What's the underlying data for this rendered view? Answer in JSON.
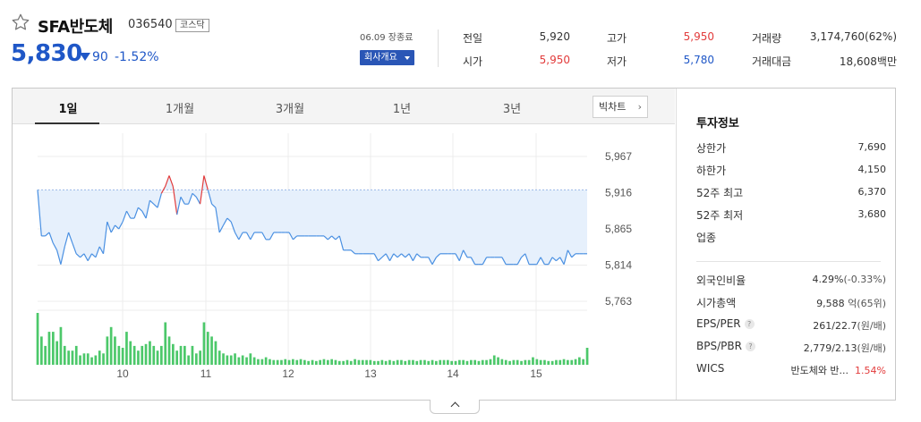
{
  "stock": {
    "name": "SFA반도체",
    "code": "036540",
    "market": "코스닥",
    "price": "5,830",
    "change": "90",
    "change_pct": "-1.52%",
    "date_label": "06.09 장종료",
    "company_btn": "회사개요"
  },
  "quote": [
    {
      "label": "전일",
      "value": "5,920",
      "color": "dark"
    },
    {
      "label": "시가",
      "value": "5,950",
      "color": "red"
    },
    {
      "label": "고가",
      "value": "5,950",
      "color": "red"
    },
    {
      "label": "저가",
      "value": "5,780",
      "color": "blue"
    },
    {
      "label": "거래량",
      "value": "3,174,760(62%)",
      "color": "dark"
    },
    {
      "label": "거래대금",
      "value": "18,608백만",
      "color": "dark"
    }
  ],
  "tabs": [
    "1일",
    "1개월",
    "3개월",
    "1년",
    "3년"
  ],
  "bigchart_label": "빅차트",
  "invest": {
    "title": "투자정보",
    "rows": [
      {
        "label": "상한가",
        "value": "7,690",
        "color": "red"
      },
      {
        "label": "하한가",
        "value": "4,150",
        "color": "blue"
      },
      {
        "label": "52주 최고",
        "value": "6,370",
        "color": "dark"
      },
      {
        "label": "52주 최저",
        "value": "3,680",
        "color": "dark"
      },
      {
        "label": "업종",
        "value": "",
        "color": "dark"
      }
    ],
    "rows2": [
      {
        "label": "외국인비율",
        "value": "4.29%",
        "extra": "(-0.33%)"
      },
      {
        "label": "시가총액",
        "value": "9,588",
        "extra": "억(65위)"
      },
      {
        "label": "EPS/PER",
        "value": "261/22.7",
        "extra": "(원/배)",
        "help": true
      },
      {
        "label": "BPS/PBR",
        "value": "2,779/2.13",
        "extra": "(원/배)",
        "help": true
      },
      {
        "label": "WICS",
        "value": "반도체와 반...",
        "extra": "1.54%"
      }
    ]
  },
  "colors": {
    "up": "#e23b3b",
    "down": "#1f57c7",
    "line": "#4a90e2",
    "area": "#e6f0fc",
    "volume": "#4cc86a"
  },
  "chart_data": {
    "type": "line",
    "y_ticks": [
      "5,967",
      "5,916",
      "5,865",
      "5,814",
      "5,763"
    ],
    "x_ticks": [
      "10",
      "11",
      "12",
      "13",
      "14",
      "15"
    ],
    "ylim": [
      5763,
      5967
    ],
    "prev_close": 5920,
    "price_series": [
      5920,
      5855,
      5855,
      5860,
      5845,
      5835,
      5815,
      5840,
      5860,
      5845,
      5830,
      5825,
      5830,
      5820,
      5830,
      5825,
      5840,
      5830,
      5875,
      5860,
      5870,
      5865,
      5875,
      5890,
      5880,
      5880,
      5895,
      5890,
      5880,
      5905,
      5900,
      5895,
      5915,
      5925,
      5940,
      5925,
      5885,
      5910,
      5900,
      5900,
      5915,
      5910,
      5900,
      5940,
      5920,
      5900,
      5895,
      5860,
      5870,
      5880,
      5875,
      5860,
      5850,
      5860,
      5860,
      5850,
      5860,
      5860,
      5860,
      5850,
      5850,
      5860,
      5860,
      5860,
      5860,
      5860,
      5850,
      5855,
      5855,
      5855,
      5855,
      5855,
      5855,
      5855,
      5855,
      5850,
      5855,
      5850,
      5855,
      5835,
      5835,
      5835,
      5830,
      5830,
      5830,
      5830,
      5830,
      5830,
      5820,
      5825,
      5830,
      5820,
      5830,
      5825,
      5830,
      5825,
      5830,
      5820,
      5830,
      5825,
      5825,
      5825,
      5815,
      5825,
      5830,
      5830,
      5830,
      5830,
      5830,
      5820,
      5835,
      5825,
      5825,
      5815,
      5815,
      5815,
      5825,
      5825,
      5825,
      5825,
      5825,
      5815,
      5815,
      5815,
      5815,
      5825,
      5830,
      5815,
      5815,
      5815,
      5825,
      5815,
      5815,
      5825,
      5820,
      5825,
      5815,
      5835,
      5825,
      5830,
      5830,
      5830,
      5830
    ],
    "volume_series": [
      55,
      30,
      20,
      35,
      35,
      25,
      40,
      20,
      15,
      15,
      20,
      10,
      12,
      12,
      8,
      10,
      15,
      12,
      30,
      40,
      30,
      20,
      18,
      35,
      25,
      20,
      15,
      20,
      22,
      25,
      20,
      15,
      20,
      45,
      30,
      22,
      15,
      20,
      20,
      10,
      20,
      12,
      15,
      45,
      35,
      30,
      25,
      15,
      12,
      10,
      10,
      12,
      8,
      10,
      8,
      12,
      8,
      6,
      6,
      8,
      6,
      5,
      5,
      5,
      6,
      5,
      6,
      5,
      6,
      5,
      4,
      5,
      4,
      5,
      6,
      5,
      6,
      5,
      4,
      4,
      5,
      4,
      6,
      5,
      5,
      5,
      5,
      4,
      4,
      5,
      4,
      5,
      4,
      5,
      5,
      4,
      5,
      5,
      4,
      5,
      5,
      4,
      5,
      4,
      5,
      5,
      5,
      4,
      4,
      5,
      5,
      4,
      5,
      5,
      4,
      5,
      5,
      6,
      10,
      8,
      6,
      5,
      4,
      5,
      5,
      4,
      5,
      5,
      8,
      6,
      5,
      5,
      4,
      4,
      5,
      5,
      6,
      5,
      5,
      6,
      8,
      6,
      18
    ]
  }
}
